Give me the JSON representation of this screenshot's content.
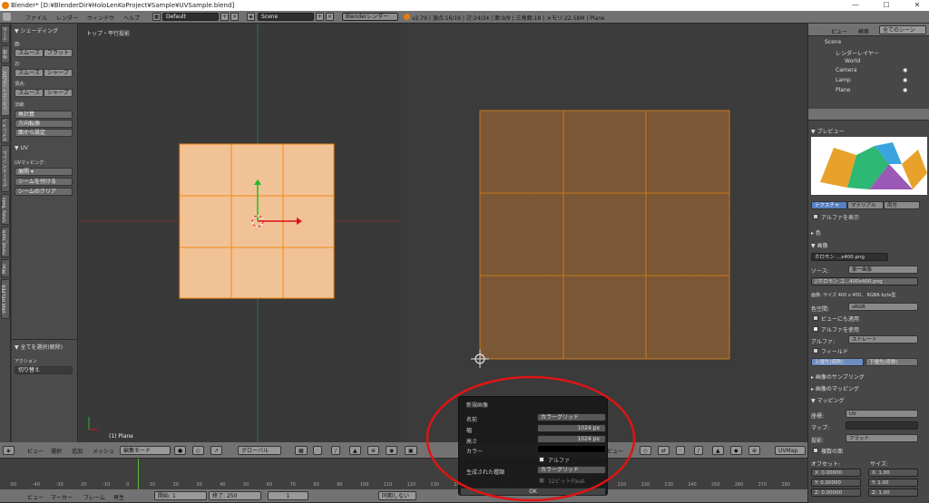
{
  "window": {
    "title": "Blender* [D:¥BlenderDir¥HoloLenKoProject¥Sample¥UVSample.blend]",
    "minimize": "—",
    "maximize": "☐",
    "close": "✕"
  },
  "topbar": {
    "menus": [
      "ファイル",
      "レンダー",
      "ウィンドウ",
      "ヘルプ"
    ],
    "layout": "Default",
    "scene": "Scene",
    "engine": "Blenderレンダー",
    "stats": "v2.79 | 頂点:16/16 | 辺:24/24 | 面:9/9 | 三角面:18 | メモリ:22.58M | Plane"
  },
  "tabs": [
    "ツール",
    "作成",
    "シェーディング/UV",
    "オプション",
    "グリースペンシル",
    "Unity Tools",
    "mmd_tools",
    "Misc",
    "VRM HELPER"
  ],
  "toolpanel": {
    "shading_title": "▼ シェーディング",
    "face_label": "面:",
    "smooth": "スムーズ",
    "flat": "フラット",
    "edge_label": "辺:",
    "smooth2": "スムーズ",
    "sharp": "シャープ",
    "vertex_label": "頂点:",
    "smooth3": "スムーズ",
    "sharp2": "シャープ",
    "normals_label": "法線:",
    "recalc": "再計算",
    "flip": "方向転換",
    "set_from_faces": "面から設定",
    "uv_title": "▼ UV",
    "uv_mapping": "UVマッピング:",
    "unwrap": "展開 ▾",
    "mark_seam": "シームを付ける",
    "clear_seam": "シームのクリア",
    "operator_title": "▼ 全てを選択(解除)",
    "action_label": "アクション",
    "action_value": "切り替え"
  },
  "viewport3d": {
    "label": "トップ・平行投影",
    "object_label": "(1) Plane"
  },
  "header3d": {
    "view": "ビュー",
    "select": "選択",
    "add": "追加",
    "mesh": "メッシュ",
    "mode": "編集モード",
    "pivot": "グローバル"
  },
  "headeruv": {
    "view": "ビュー",
    "uvmap": "UVMap"
  },
  "outliner": {
    "view": "ビュー",
    "search": "検索",
    "filter": "全てのシーン",
    "items": [
      {
        "label": "Scene"
      },
      {
        "label": "レンダーレイヤー"
      },
      {
        "label": "World"
      },
      {
        "label": "Camera"
      },
      {
        "label": "Lamp"
      },
      {
        "label": "Plane"
      }
    ]
  },
  "properties": {
    "preview": "▼ プレビュー",
    "tabs": [
      "テクスチャ",
      "マテリアル",
      "両方"
    ],
    "show_alpha": "アルファを表示",
    "color": "▸ 色",
    "image": "▼ 画像",
    "image_name": "ホロモン ...x400.png",
    "source_label": "ソース:",
    "source_value": "単一画像",
    "file_name": "//ホロモン ゴ...400x400.png",
    "image_info": "画像: サイズ 400 x 400、 RGBA byte型",
    "colorspace_label": "色空間:",
    "colorspace_value": "sRGB",
    "view_as_render": "ビューにも適用",
    "use_alpha": "アルファを使用",
    "alpha_label": "アルファ:",
    "alpha_value": "ストレート",
    "fields": "フィールド",
    "upper_first": "上優先(偶数)",
    "lower_first": "下優先(奇数)",
    "sampling": "▸ 画像のサンプリング",
    "mapping_img": "▸ 画像のマッピング",
    "mapping": "▼ マッピング",
    "coords_label": "座標:",
    "coords_value": "UV",
    "map_label": "マップ:",
    "projection_label": "投影:",
    "projection_value": "フラット",
    "multi_label": "複数の面",
    "offset_label": "オフセット:",
    "size_label": "サイズ:",
    "ox": "X:",
    "oy": "Y:",
    "oz": "Z:",
    "ov": [
      "0.00000",
      "0.00000",
      "0.00000"
    ],
    "sv": [
      "1.00",
      "1.00",
      "1.00"
    ]
  },
  "timeline": {
    "ticks": [
      "-50",
      "-40",
      "-30",
      "-20",
      "-10",
      "0",
      "10",
      "20",
      "30",
      "40",
      "50",
      "60",
      "70",
      "80",
      "90",
      "100",
      "110",
      "120",
      "130",
      "140",
      "150",
      "160",
      "170",
      "180",
      "190",
      "200",
      "210",
      "220",
      "230",
      "240",
      "250",
      "260",
      "270",
      "280"
    ],
    "view": "ビュー",
    "marker": "マーカー",
    "frame": "フレーム",
    "play": "再生",
    "start_label": "開始:",
    "start": "1",
    "end_label": "終了:",
    "end": "250",
    "current": "1",
    "sync": "同期しない"
  },
  "popup": {
    "title": "新規画像",
    "name_label": "名前",
    "name_value": "カラーグリッド",
    "width_label": "幅",
    "width_value": "1024 px",
    "height_label": "高さ",
    "height_value": "1024 px",
    "color_label": "カラー",
    "alpha_label": "アルファ",
    "gen_label": "生成された種類",
    "gen_value": "カラーグリッド",
    "float_label": "32ビットFloat",
    "ok": "OK"
  }
}
